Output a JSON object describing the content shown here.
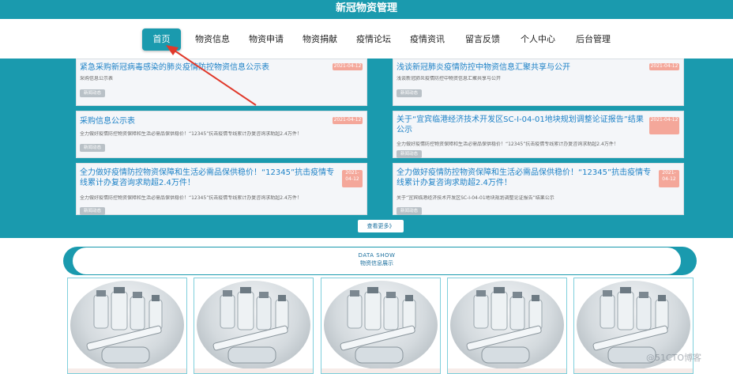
{
  "app": {
    "title": "新冠物资管理"
  },
  "nav": {
    "items": [
      {
        "label": "首页",
        "active": true
      },
      {
        "label": "物资信息"
      },
      {
        "label": "物资申请"
      },
      {
        "label": "物资捐献"
      },
      {
        "label": "疫情论坛"
      },
      {
        "label": "疫情资讯"
      },
      {
        "label": "留言反馈"
      },
      {
        "label": "个人中心"
      },
      {
        "label": "后台管理"
      }
    ]
  },
  "news": {
    "items": [
      {
        "title": "紧急采购新冠病毒感染的肺炎疫情防控物资信息公示表",
        "desc": "采购信息公示表",
        "tag": "新闻动态",
        "date": "2021-04-12"
      },
      {
        "title": "浅谈新冠肺炎疫情防控中物资信息汇聚共享与公开",
        "desc": "浅谈新冠肺炎疫情防控中物资信息汇聚共享与公开",
        "tag": "新闻动态",
        "date": "2021-04-12"
      },
      {
        "title": "采购信息公示表",
        "desc": "全力做好疫情防控物资保障和生活必需品保供稳价！“12345”抗击疫情专线累计办复咨询求助超2.4万件！",
        "tag": "新闻动态",
        "date": "2021-04-12"
      },
      {
        "title": "关于“宜宾临港经济技术开发区SC-I-04-01地块规划调整论证报告”结果公示",
        "desc": "全力做好疫情防控物资保障和生活必需品保供稳价！“12345”抗击疫情专线累计办复咨询求助超2.4万件！",
        "tag": "新闻动态",
        "date": "2021-04-12"
      },
      {
        "title": "全力做好疫情防控物资保障和生活必需品保供稳价！“12345”抗击疫情专线累计办复咨询求助超2.4万件！",
        "desc": "全力做好疫情防控物资保障和生活必需品保供稳价！“12345”抗击疫情专线累计办复咨询求助超2.4万件！",
        "tag": "新闻动态",
        "date": "2021-04-12"
      },
      {
        "title": "全力做好疫情防控物资保障和生活必需品保供稳价！“12345”抗击疫情专线累计办复咨询求助超2.4万件！",
        "desc": "关于“宜宾临港经济技术开发区SC-I-04-01地块规划调整论证报告”结果公示",
        "tag": "新闻动态",
        "date": "2021-04-12"
      }
    ],
    "more_label": "查看更多》"
  },
  "data_show": {
    "title_en": "DATA SHOW",
    "title_cn": "物资信息展示"
  },
  "products": {
    "image_icon": "vials-syringe-image",
    "count": 5
  },
  "watermark": "@51CTO博客",
  "colors": {
    "accent": "#1a9aae",
    "link": "#1e82c7",
    "date_badge": "#f4a79a",
    "arrow": "#e0392b"
  }
}
